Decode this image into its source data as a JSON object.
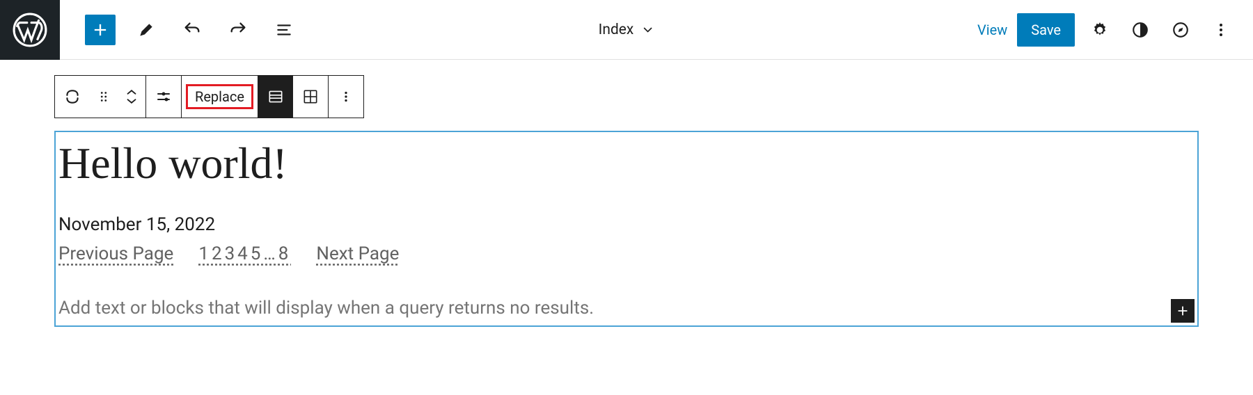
{
  "header": {
    "template_name": "Index",
    "view_label": "View",
    "save_label": "Save"
  },
  "block_toolbar": {
    "replace_label": "Replace"
  },
  "content": {
    "post_title": "Hello world!",
    "post_date": "November 15, 2022",
    "pagination": {
      "prev": "Previous Page",
      "pages": "12345…8",
      "next": "Next Page"
    },
    "no_results_placeholder": "Add text or blocks that will display when a query returns no results."
  },
  "colors": {
    "primary": "#007cba",
    "highlight": "#e31b23",
    "selection": "#4ba3d6"
  }
}
